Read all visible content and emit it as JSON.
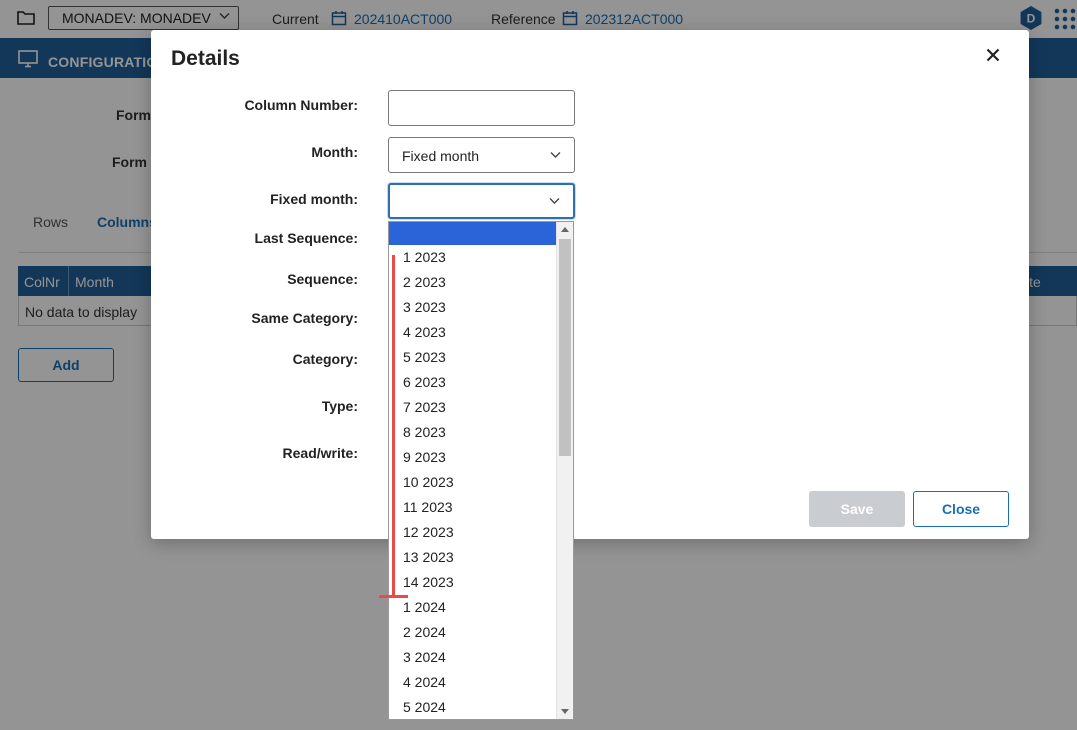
{
  "topbar": {
    "environment": "MONADEV: MONADEV",
    "current_label": "Current",
    "current_value": "202410ACT000",
    "reference_label": "Reference",
    "reference_value": "202312ACT000",
    "badge": "D"
  },
  "band": {
    "title": "CONFIGURATIO"
  },
  "background": {
    "form_label_1": "Form",
    "form_label_2": "Form N",
    "tabs": [
      "Rows",
      "Columns"
    ],
    "grid_columns": [
      "ColNr",
      "Month",
      "ite"
    ],
    "empty_text": "No data to display",
    "add_label": "Add"
  },
  "modal": {
    "title": "Details",
    "labels": {
      "column_number": "Column Number:",
      "month": "Month:",
      "fixed_month": "Fixed month:",
      "last_sequence": "Last Sequence:",
      "sequence": "Sequence:",
      "same_category": "Same Category:",
      "category": "Category:",
      "type": "Type:",
      "read_write": "Read/write:"
    },
    "column_number_value": "",
    "month_value": "Fixed month",
    "fixed_month_value": "",
    "save_label": "Save",
    "close_label": "Close"
  },
  "dropdown": {
    "options": [
      "",
      "1 2023",
      "2 2023",
      "3 2023",
      "4 2023",
      "5 2023",
      "6 2023",
      "7 2023",
      "8 2023",
      "9 2023",
      "10 2023",
      "11 2023",
      "12 2023",
      "13 2023",
      "14 2023",
      "1 2024",
      "2 2024",
      "3 2024",
      "4 2024",
      "5 2024"
    ]
  },
  "colors": {
    "brand_blue": "#1f5f99",
    "link_blue": "#1a6fb3",
    "selected_option": "#2b64d8",
    "annotation_red": "#e94a4a"
  }
}
